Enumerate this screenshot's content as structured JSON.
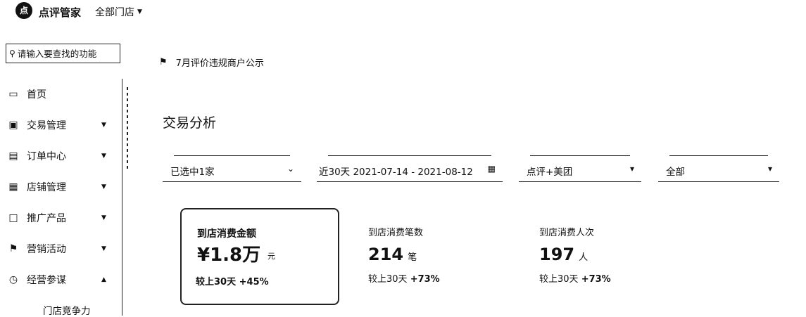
{
  "header": {
    "logo_text": "点",
    "brand": "点评管家",
    "store_select": "全部门店"
  },
  "search": {
    "placeholder": "请输入要查找的功能"
  },
  "sidebar": {
    "items": [
      {
        "label": "首页",
        "icon": "home-icon",
        "arrow": ""
      },
      {
        "label": "交易管理",
        "icon": "trade-icon",
        "arrow": "▼"
      },
      {
        "label": "订单中心",
        "icon": "order-icon",
        "arrow": "▼"
      },
      {
        "label": "店铺管理",
        "icon": "store-icon",
        "arrow": "▼"
      },
      {
        "label": "推广产品",
        "icon": "promo-icon",
        "arrow": "▼"
      },
      {
        "label": "营销活动",
        "icon": "campaign-icon",
        "arrow": "▼"
      },
      {
        "label": "经营参谋",
        "icon": "analytics-icon",
        "arrow": "▲"
      }
    ],
    "sub_item": "门店竞争力"
  },
  "notice": {
    "text": "7月评价违规商户公示",
    "icon": "megaphone-icon"
  },
  "section_title": "交易分析",
  "filters": {
    "store": "已选中1家",
    "date_range": "近30天  2021-07-14 - 2021-08-12",
    "platform": "点评+美团",
    "category": "全部"
  },
  "metrics": [
    {
      "label": "到店消费金额",
      "value": "¥1.8万",
      "unit": "元",
      "compare_prefix": "较上30天",
      "compare_delta": "+45%"
    },
    {
      "label": "到店消费笔数",
      "value": "214",
      "unit": "笔",
      "compare_prefix": "较上30天",
      "compare_delta": "+73%"
    },
    {
      "label": "到店消费人次",
      "value": "197",
      "unit": "人",
      "compare_prefix": "较上30天",
      "compare_delta": "+73%"
    }
  ]
}
